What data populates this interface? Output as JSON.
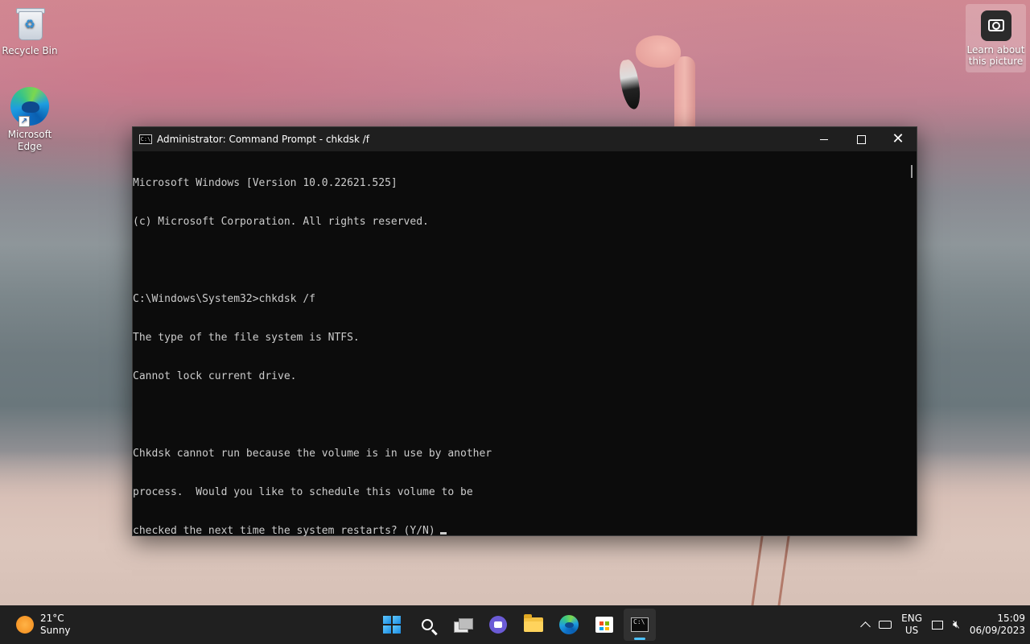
{
  "desktop": {
    "icons": [
      {
        "label": "Recycle Bin"
      },
      {
        "label": "Microsoft Edge"
      }
    ],
    "learn_picture": "Learn about this picture"
  },
  "window": {
    "title": "Administrator: Command Prompt - chkdsk  /f",
    "console_lines": [
      "Microsoft Windows [Version 10.0.22621.525]",
      "(c) Microsoft Corporation. All rights reserved.",
      "",
      "C:\\Windows\\System32>chkdsk /f",
      "The type of the file system is NTFS.",
      "Cannot lock current drive.",
      "",
      "Chkdsk cannot run because the volume is in use by another",
      "process.  Would you like to schedule this volume to be",
      "checked the next time the system restarts? (Y/N)"
    ]
  },
  "taskbar": {
    "weather": {
      "temp": "21°C",
      "condition": "Sunny"
    },
    "apps": [
      "start-icon",
      "search-icon",
      "task-view-icon",
      "chat-icon",
      "file-explorer-icon",
      "edge-icon",
      "store-icon",
      "command-prompt-icon"
    ],
    "active_app": "command-prompt-icon",
    "tray": {
      "lang_line1": "ENG",
      "lang_line2": "US",
      "time": "15:09",
      "date": "06/09/2023"
    }
  },
  "colors": {
    "console_bg": "#0c0c0c",
    "console_text": "#cccccc",
    "titlebar": "#1f1f1f",
    "taskbar": "#202020",
    "accent": "#4cc2ff"
  }
}
